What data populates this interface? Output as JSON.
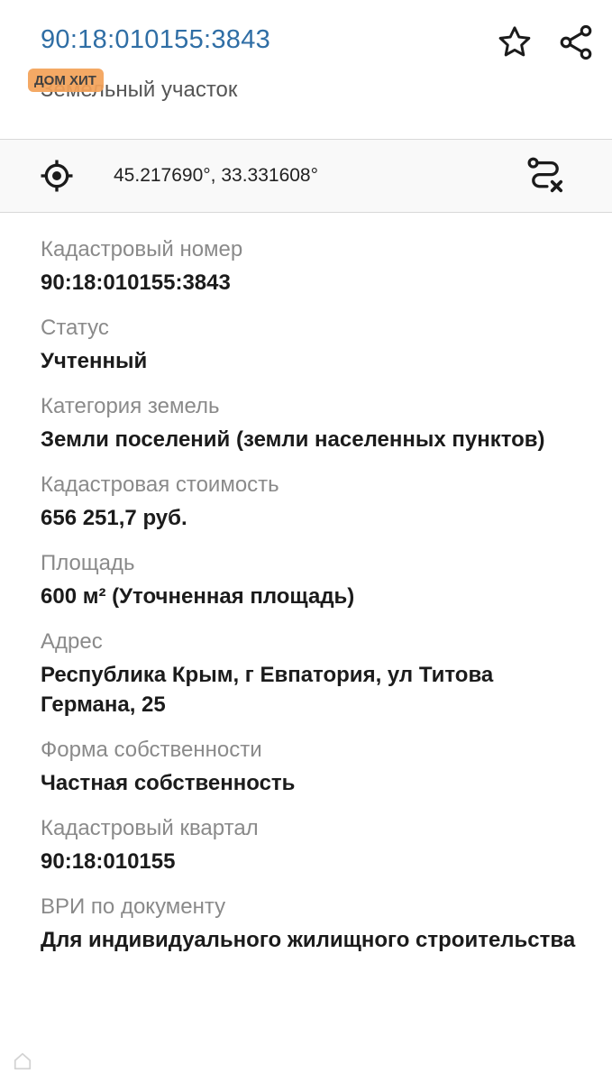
{
  "header": {
    "title": "90:18:010155:3843",
    "subtitle": "Земельный участок",
    "badge": "ДОМ ХИТ",
    "star_icon": "star-outline-icon",
    "share_icon": "share-icon"
  },
  "coords_bar": {
    "coordinates": "45.217690°, 33.331608°",
    "locate_icon": "target-icon",
    "route_icon": "route-clear-icon"
  },
  "colors": {
    "title": "#2f6ea5",
    "label": "#8a8a8a",
    "value": "#1b1b1b",
    "badge": "#f4a259"
  },
  "fields": [
    {
      "label": "Кадастровый номер",
      "value": "90:18:010155:3843"
    },
    {
      "label": "Статус",
      "value": "Учтенный"
    },
    {
      "label": "Категория земель",
      "value": "Земли поселений (земли населенных пунктов)"
    },
    {
      "label": "Кадастровая стоимость",
      "value": "656 251,7 руб."
    },
    {
      "label": "Площадь",
      "value": "600 м² (Уточненная площадь)"
    },
    {
      "label": "Адрес",
      "value": "Республика Крым, г Евпатория, ул Титова Германа, 25"
    },
    {
      "label": "Форма собственности",
      "value": "Частная собственность"
    },
    {
      "label": "Кадастровый квартал",
      "value": "90:18:010155"
    },
    {
      "label": "ВРИ по документу",
      "value": "Для индивидуального жилищного строительства"
    }
  ]
}
